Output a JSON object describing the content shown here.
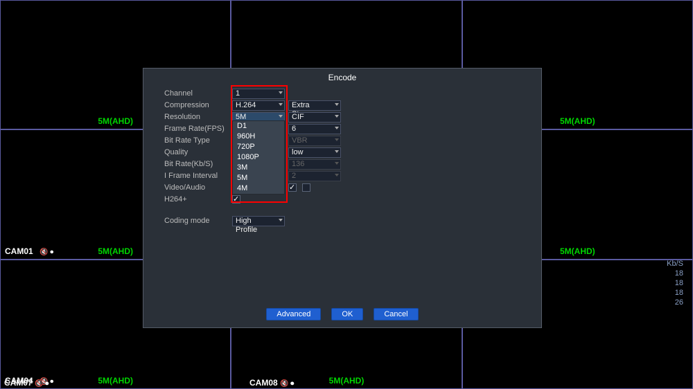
{
  "grid": {
    "cells": [
      {
        "cam": "",
        "res": "5M(AHD)"
      },
      {
        "cam": "",
        "res": "5M(AHD)"
      },
      {
        "cam": "",
        "res": "5M(AHD)"
      },
      {
        "cam": "CAM01",
        "res": "5M(AHD)"
      },
      {
        "cam": "",
        "res": ""
      },
      {
        "cam": "",
        "res": "5M(AHD)"
      },
      {
        "cam": "CAM04",
        "res": "5M(AHD)"
      },
      {
        "cam": "",
        "res": "5M(AHD)"
      },
      {
        "cam": "",
        "res": ""
      },
      {
        "cam": "CAM07",
        "res": ""
      },
      {
        "cam": "CAM08",
        "res": ""
      },
      {
        "cam": "",
        "res": ""
      }
    ]
  },
  "stats": {
    "header": "Kb/S",
    "rows": [
      "18",
      "18",
      "18",
      "26"
    ]
  },
  "dialog": {
    "title": "Encode",
    "labels": {
      "channel": "Channel",
      "compression": "Compression",
      "resolution": "Resolution",
      "fps": "Frame Rate(FPS)",
      "brtype": "Bit Rate Type",
      "quality": "Quality",
      "bitrate": "Bit Rate(Kb/S)",
      "iframe": "I Frame Interval",
      "va": "Video/Audio",
      "h264p": "H264+",
      "coding": "Coding mode"
    },
    "main": {
      "channel": "1",
      "compression": "H.264",
      "resolution": "5M",
      "fps": "",
      "brtype": "",
      "quality": "",
      "bitrate": "",
      "iframe": "",
      "coding": "High Profile"
    },
    "extra": {
      "compression": "Extra Stream",
      "resolution": "CIF",
      "fps": "6",
      "brtype": "VBR",
      "quality": "low",
      "bitrate": "136",
      "iframe": "2"
    },
    "dropdown": {
      "options": [
        "D1",
        "960H",
        "720P",
        "1080P",
        "3M",
        "5M",
        "4M"
      ]
    },
    "buttons": {
      "advanced": "Advanced",
      "ok": "OK",
      "cancel": "Cancel"
    }
  }
}
